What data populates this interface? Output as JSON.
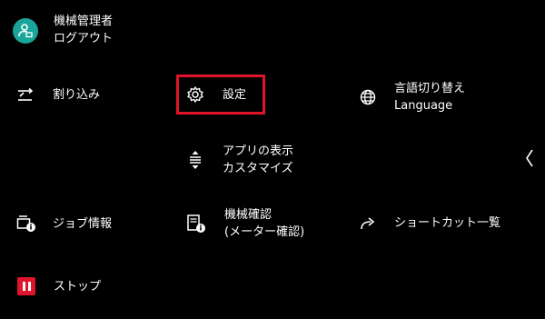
{
  "user": {
    "name": "機械管理者",
    "logout": "ログアウト",
    "avatar_icon": "user-monitor-icon",
    "avatar_color": "#1aa59a"
  },
  "menu": {
    "interrupt": {
      "label": "割り込み",
      "icon": "interrupt-icon"
    },
    "settings": {
      "label": "設定",
      "icon": "gear-icon",
      "highlight_color": "#e0142a"
    },
    "language": {
      "label1": "言語切り替え",
      "label2": "Language",
      "icon": "globe-icon"
    },
    "customize": {
      "label1": "アプリの表示",
      "label2": "カスタマイズ",
      "icon": "sort-arrows-icon"
    },
    "job_info": {
      "label": "ジョブ情報",
      "icon": "printer-info-icon"
    },
    "machine_check": {
      "label1": "機械確認",
      "label2": "(メーター確認)",
      "icon": "machine-info-icon"
    },
    "shortcut": {
      "label": "ショートカット一覧",
      "icon": "share-arrow-icon"
    },
    "stop": {
      "label": "ストップ",
      "icon": "pause-icon",
      "color": "#e0142a"
    }
  },
  "nav": {
    "collapse_icon": "chevron-left-icon"
  }
}
